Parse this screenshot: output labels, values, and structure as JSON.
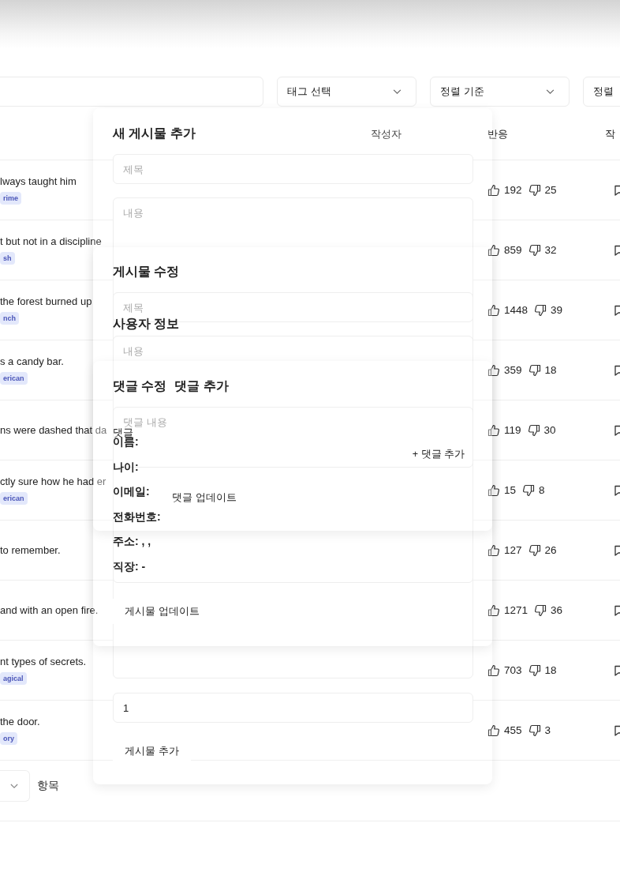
{
  "filters": [
    {
      "label": "태그 선택"
    },
    {
      "label": "정렬 기준"
    },
    {
      "label": "정렬"
    }
  ],
  "table": {
    "columns": [
      "작성자",
      "반응",
      "작"
    ],
    "rows": [
      {
        "title": "lways taught him",
        "tag": "rime",
        "likes": "192",
        "dislikes": "25"
      },
      {
        "title": "t but not in a discipline",
        "tag": "sh",
        "likes": "859",
        "dislikes": "32"
      },
      {
        "title": "the forest burned up",
        "tag": "nch",
        "likes": "1448",
        "dislikes": "39"
      },
      {
        "title": "s a candy bar.",
        "tag": "erican",
        "likes": "359",
        "dislikes": "18"
      },
      {
        "title": "ns were dashed that da",
        "likes": "119",
        "dislikes": "30"
      },
      {
        "title": "ctly sure how he had er",
        "tag": "erican",
        "likes": "15",
        "dislikes": "8"
      },
      {
        "title": "to remember.",
        "likes": "127",
        "dislikes": "26"
      },
      {
        "title": "and with an open fire.",
        "likes": "1271",
        "dislikes": "36"
      },
      {
        "title": "nt types of secrets.",
        "tag": "agical",
        "likes": "703",
        "dislikes": "18"
      },
      {
        "title": "the door.",
        "tag": "ory",
        "likes": "455",
        "dislikes": "3"
      }
    ]
  },
  "pagination": {
    "label": "항목"
  },
  "new_post_dialog": {
    "title": "새 게시물 추가",
    "title_placeholder": "제목",
    "content_placeholder": "내용",
    "value": "1",
    "button": "게시물 추가"
  },
  "edit_post_dialog": {
    "title": "게시물 수정",
    "title_placeholder": "제목",
    "content_placeholder": "내용",
    "button": "게시물 업데이트"
  },
  "user_info_dialog": {
    "title": "사용자 정보",
    "fields": [
      "이름:",
      "나이:",
      "이메일:",
      "전화번호:",
      "주소: , ,",
      "직장: -"
    ]
  },
  "comment_dialog": {
    "titles": [
      "댓글 수정",
      "댓글 추가"
    ],
    "placeholder": "댓글 내용",
    "label": "댓글",
    "add_button": "+ 댓글 추가",
    "update_button": "댓글 업데이트"
  }
}
